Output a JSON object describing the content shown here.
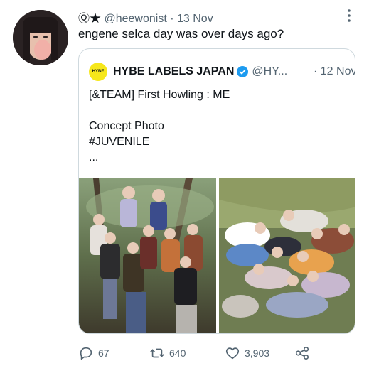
{
  "tweet": {
    "display_name": "Ⓠ★",
    "handle": "@heewonist",
    "separator": "·",
    "time": "13 Nov",
    "text": "engene selca day was over days ago?"
  },
  "quoted": {
    "logo_text": "HYBE",
    "name": "HYBE LABELS JAPAN",
    "handle": "@HY...",
    "time": "· 12 Nov",
    "lines": [
      "[&TEAM] First Howling : ME",
      "",
      "Concept Photo",
      "#JUVENILE",
      "..."
    ]
  },
  "actions": {
    "replies": "67",
    "retweets": "640",
    "likes": "3,903"
  },
  "colors": {
    "text": "#0f1419",
    "muted": "#536471",
    "border": "#cfd9de",
    "verified": "#1d9bf0",
    "logo": "#f6e71b"
  },
  "icons": [
    "more-icon",
    "verified-icon",
    "reply-icon",
    "retweet-icon",
    "like-icon",
    "share-icon"
  ]
}
